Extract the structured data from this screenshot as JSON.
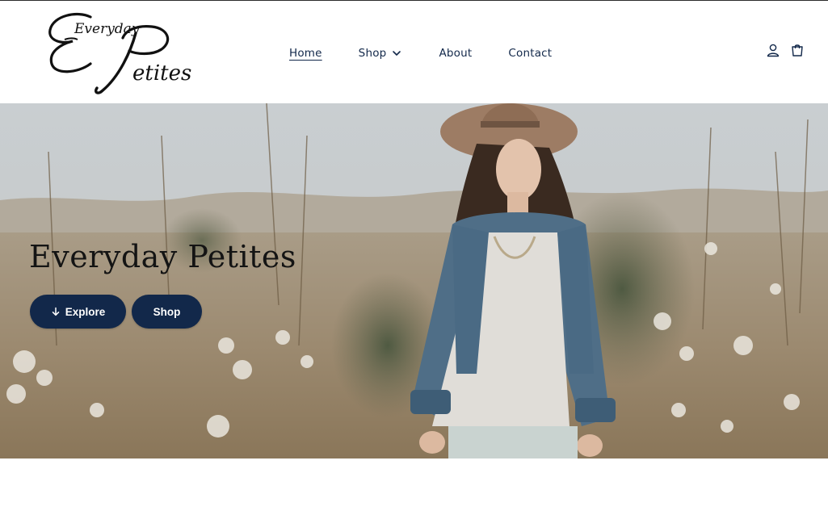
{
  "brand": {
    "logo_line1": "Everyday",
    "logo_line2": "Petites"
  },
  "nav": {
    "items": [
      {
        "label": "Home",
        "active": true
      },
      {
        "label": "Shop",
        "has_dropdown": true
      },
      {
        "label": "About"
      },
      {
        "label": "Contact"
      }
    ]
  },
  "header_icons": [
    "account-icon",
    "cart-icon"
  ],
  "hero": {
    "title": "Everyday Petites",
    "buttons": [
      {
        "label": "Explore",
        "icon": "arrow-down-icon"
      },
      {
        "label": "Shop"
      }
    ]
  },
  "colors": {
    "accent": "#12284a",
    "text_dark": "#141414",
    "background": "#ffffff"
  }
}
